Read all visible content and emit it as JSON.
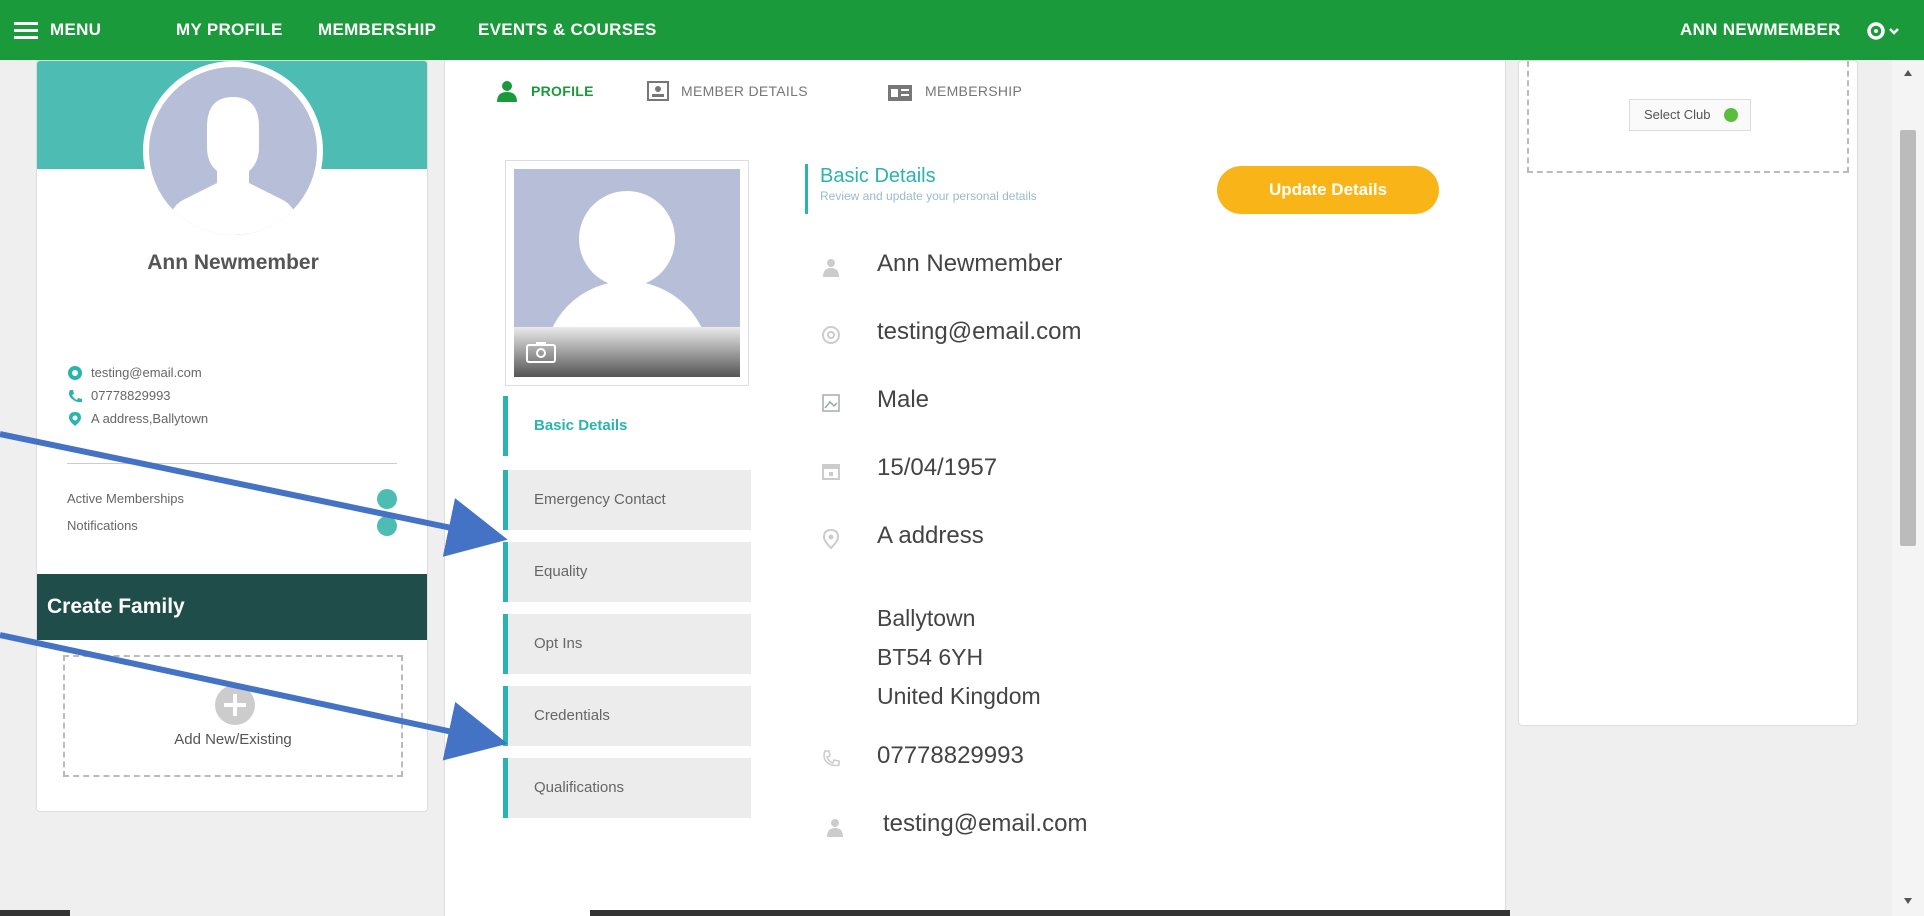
{
  "nav": {
    "menu_label": "MENU",
    "my_profile": "MY PROFILE",
    "membership": "MEMBERSHIP",
    "events_courses": "EVENTS & COURSES",
    "user_name": "ANN NEWMEMBER"
  },
  "left_card": {
    "name": "Ann Newmember",
    "email": "testing@email.com",
    "phone": "07778829993",
    "address": "A address,Ballytown",
    "active_memberships_label": "Active Memberships",
    "notifications_label": "Notifications",
    "create_family_label": "Create Family",
    "add_new_existing_label": "Add New/Existing"
  },
  "subtabs": {
    "profile": "PROFILE",
    "member_details": "MEMBER DETAILS",
    "membership": "MEMBERSHIP"
  },
  "side_tabs": [
    {
      "label": "Basic Details",
      "active": true
    },
    {
      "label": "Emergency Contact",
      "active": false
    },
    {
      "label": "Equality",
      "active": false
    },
    {
      "label": "Opt Ins",
      "active": false
    },
    {
      "label": "Credentials",
      "active": false
    },
    {
      "label": "Qualifications",
      "active": false
    }
  ],
  "basic_details": {
    "title": "Basic Details",
    "subtitle": "Review and update your personal details",
    "update_button": "Update Details",
    "name": "Ann Newmember",
    "email": "testing@email.com",
    "gender": "Male",
    "dob": "15/04/1957",
    "address_line1": "A address",
    "address_line2": "Ballytown",
    "address_line3": "BT54 6YH",
    "address_line4": "United Kingdom",
    "phone": "07778829993",
    "username": "testing@email.com"
  },
  "right_card": {
    "select_club": "Select Club"
  },
  "colors": {
    "topbar": "#1a9a3a",
    "teal": "#2bb3b0",
    "dark_teal": "#1f4d4a",
    "update_button": "#f9b417",
    "arrow": "#4472c4"
  }
}
